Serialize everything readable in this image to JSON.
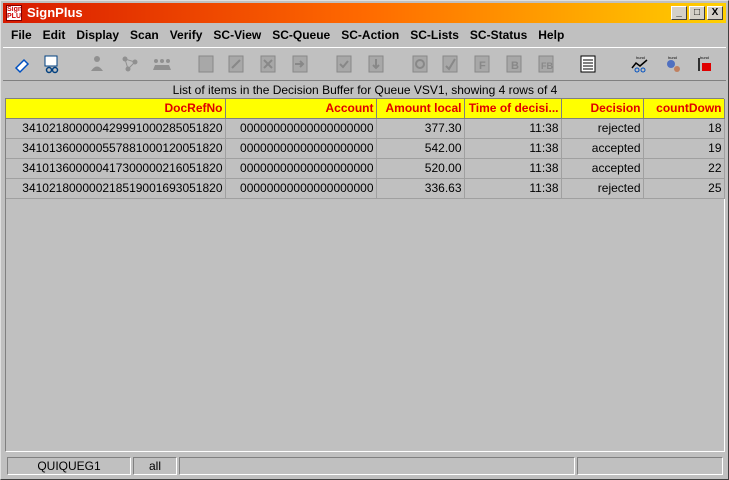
{
  "window": {
    "title": "SignPlus",
    "icon_text": "Sign PLUS",
    "minimize_label": "_",
    "maximize_label": "□",
    "close_label": "X"
  },
  "menu": {
    "items": [
      {
        "label": "File"
      },
      {
        "label": "Edit"
      },
      {
        "label": "Display"
      },
      {
        "label": "Scan"
      },
      {
        "label": "Verify"
      },
      {
        "label": "SC-View"
      },
      {
        "label": "SC-Queue"
      },
      {
        "label": "SC-Action"
      },
      {
        "label": "SC-Lists"
      },
      {
        "label": "SC-Status"
      },
      {
        "label": "Help"
      }
    ]
  },
  "toolbar": {
    "icons": [
      "eraser-icon",
      "grid-glasses-icon",
      "user-edit-icon",
      "network-icon",
      "users-group-icon",
      "document-icon",
      "document-edit-icon",
      "document-cross-icon",
      "document-arrow-icon",
      "document-check-icon",
      "document-down-icon",
      "refresh-doc-icon",
      "check-doc-icon",
      "f-doc-icon",
      "b-doc-icon",
      "fb-doc-icon",
      "list-icon",
      "hund-chart-icon",
      "hund-user-icon",
      "hund-stop-icon"
    ],
    "hund_label": "hund"
  },
  "table": {
    "caption": "List of items in the Decision Buffer for Queue VSV1, showing 4 rows of 4",
    "columns": [
      "DocRefNo",
      "Account",
      "Amount local",
      "Time of decisi...",
      "Decision",
      "countDown"
    ],
    "rows": [
      [
        "341021800000429991000285051820",
        "00000000000000000000",
        "377.30",
        "11:38",
        "rejected",
        "18"
      ],
      [
        "341013600000557881000120051820",
        "00000000000000000000",
        "542.00",
        "11:38",
        "accepted",
        "19"
      ],
      [
        "341013600000417300000216051820",
        "00000000000000000000",
        "520.00",
        "11:38",
        "accepted",
        "22"
      ],
      [
        "341021800000218519001693051820",
        "00000000000000000000",
        "336.63",
        "11:38",
        "rejected",
        "25"
      ]
    ]
  },
  "status": {
    "queue": "QUIQUEG1",
    "filter": "all",
    "message": "",
    "extra": ""
  }
}
